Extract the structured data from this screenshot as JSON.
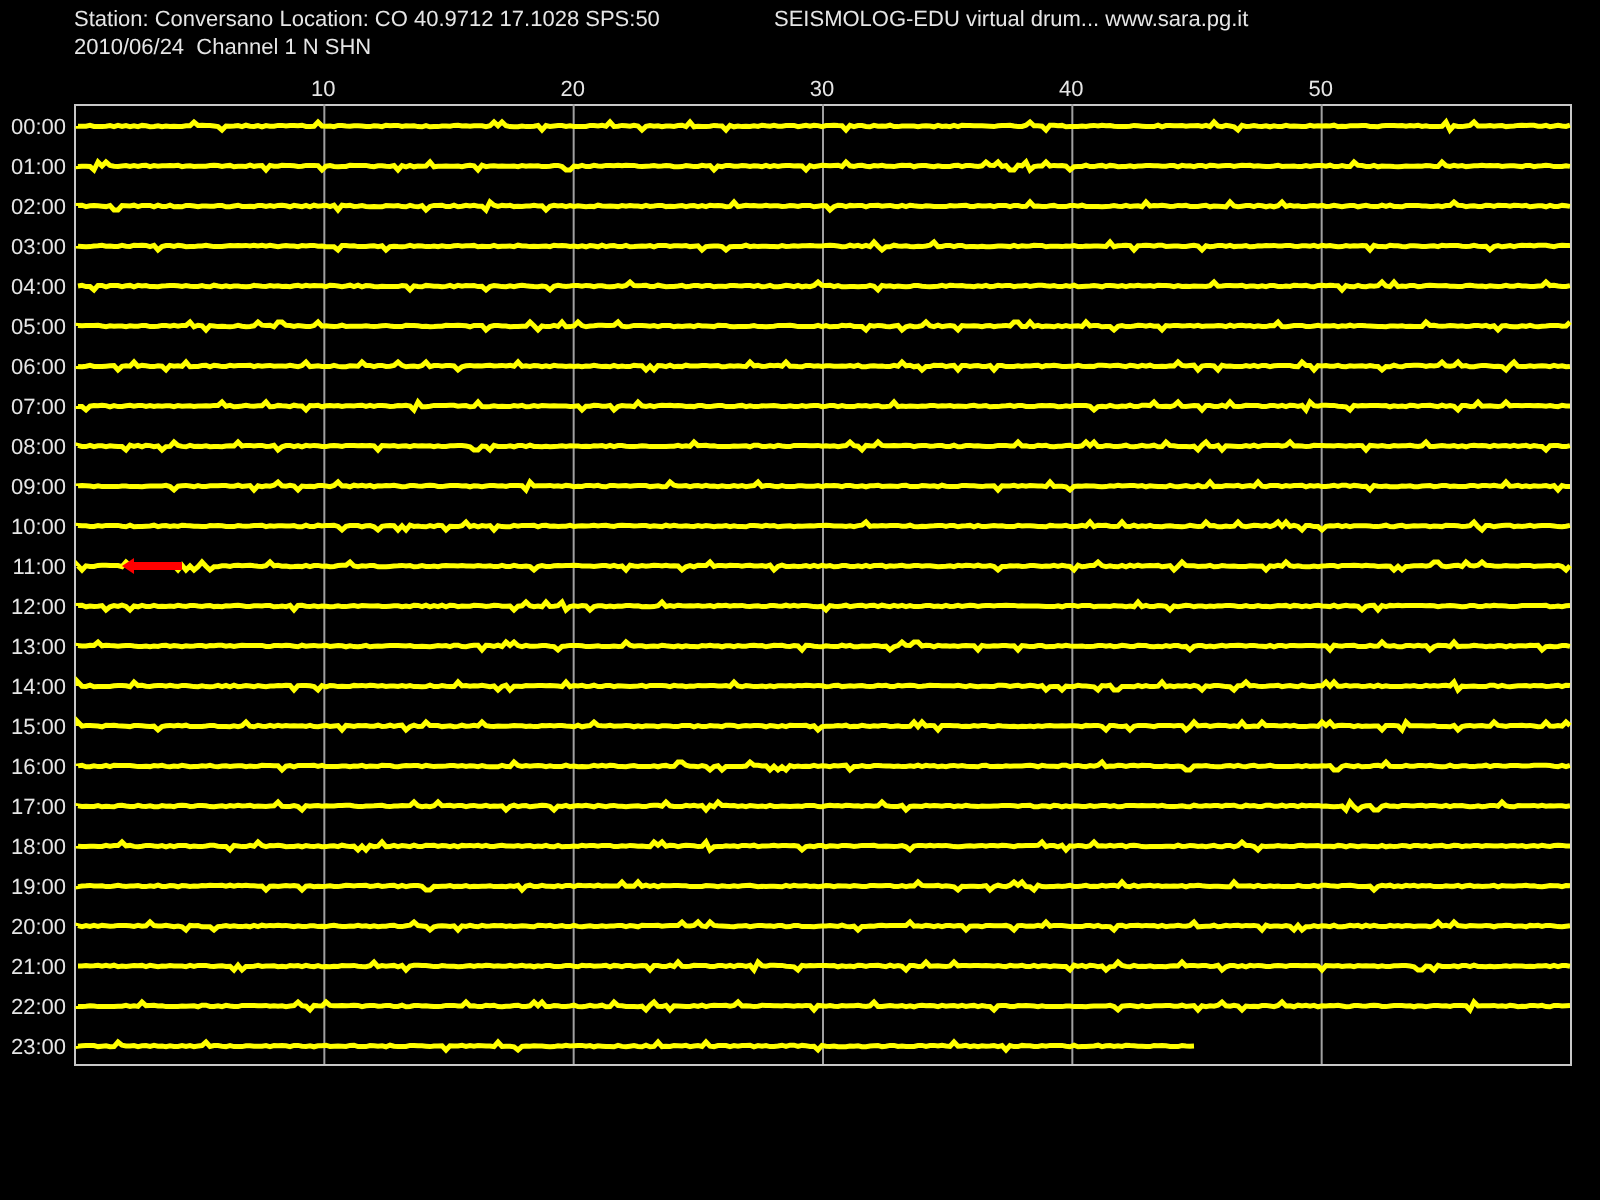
{
  "header": {
    "station_info": "Station: Conversano Location: CO 40.9712 17.1028 SPS:50",
    "title": "SEISMOLOG-EDU virtual drum... www.sara.pg.it",
    "date_channel": "2010/06/24  Channel 1 N SHN"
  },
  "minute_ticks": [
    "10",
    "20",
    "30",
    "40",
    "50"
  ],
  "rows": [
    {
      "time": "00:00",
      "level": 1,
      "event": false
    },
    {
      "time": "01:00",
      "level": 1,
      "event": false
    },
    {
      "time": "02:00",
      "level": 1,
      "event": false
    },
    {
      "time": "03:00",
      "level": 1,
      "event": false
    },
    {
      "time": "04:00",
      "level": 1,
      "event": false
    },
    {
      "time": "05:00",
      "level": 1,
      "event": false
    },
    {
      "time": "06:00",
      "level": 1,
      "event": false
    },
    {
      "time": "07:00",
      "level": 1,
      "event": false
    },
    {
      "time": "08:00",
      "level": 1,
      "event": false
    },
    {
      "time": "09:00",
      "level": 1,
      "event": false
    },
    {
      "time": "10:00",
      "level": 1,
      "event": false
    },
    {
      "time": "11:00",
      "level": 1,
      "event": true
    },
    {
      "time": "12:00",
      "level": 1,
      "event": false
    },
    {
      "time": "13:00",
      "level": 1,
      "event": false
    },
    {
      "time": "14:00",
      "level": 1,
      "event": false
    },
    {
      "time": "15:00",
      "level": 1,
      "event": false
    },
    {
      "time": "16:00",
      "level": 1,
      "event": false
    },
    {
      "time": "17:00",
      "level": 1,
      "event": false
    },
    {
      "time": "18:00",
      "level": 1,
      "event": false
    },
    {
      "time": "19:00",
      "level": 1,
      "event": false
    },
    {
      "time": "20:00",
      "level": 1,
      "event": false
    },
    {
      "time": "21:00",
      "level": 1,
      "event": false
    },
    {
      "time": "22:00",
      "level": 1,
      "event": false
    },
    {
      "time": "23:00",
      "level": 0.75,
      "event": false
    }
  ]
}
